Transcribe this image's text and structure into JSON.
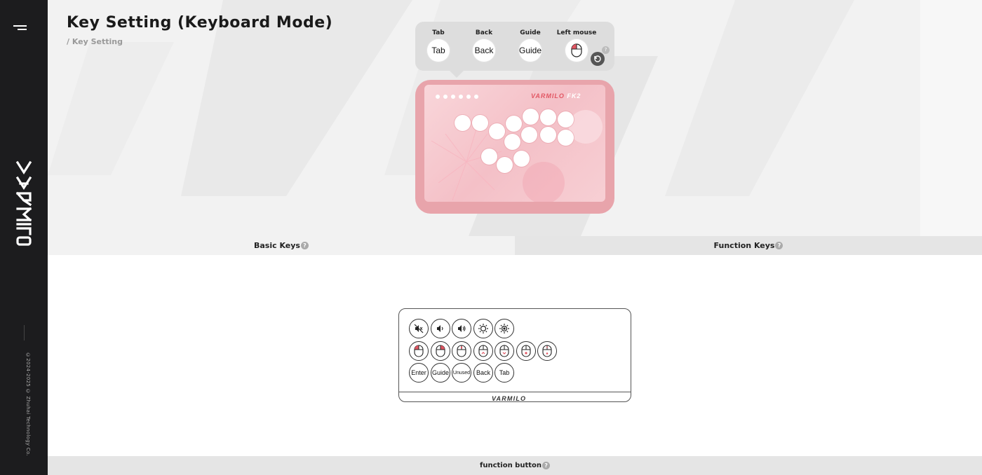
{
  "sidebar": {
    "brand": "VARMILO",
    "copyright": "©2024-2025 © Zhuhai Technology Co."
  },
  "header": {
    "title": "Key Setting (Keyboard Mode)",
    "breadcrumb": "/ Key Setting"
  },
  "keymap": {
    "keys": [
      {
        "label": "Tab",
        "value": "Tab"
      },
      {
        "label": "Back",
        "value": "Back"
      },
      {
        "label": "Guide",
        "value": "Guide"
      },
      {
        "label": "Left mouse",
        "value": "mouse-left-icon"
      }
    ],
    "reset_icon": "reset-icon",
    "help": "?"
  },
  "device": {
    "brand": "VARMILO",
    "model": "FK2",
    "accent": "#e8a4ab"
  },
  "tabs": [
    {
      "label": "Basic Keys",
      "help": "?"
    },
    {
      "label": "Function Keys",
      "help": "?"
    }
  ],
  "function_panel": {
    "row1": [
      "mute-icon",
      "volume-down-icon",
      "volume-up-icon",
      "brightness-down-icon",
      "brightness-up-icon"
    ],
    "row2": [
      "mouse-left-icon",
      "mouse-right-icon",
      "mouse-middle-icon",
      "mouse-scroll-up-icon",
      "mouse-scroll-down-icon",
      "mouse-back-icon",
      "mouse-forward-icon"
    ],
    "row3": [
      "Enter",
      "Guide",
      "Unused",
      "Back",
      "Tab"
    ],
    "brand": "VARMILO"
  },
  "footer": {
    "label": "function button",
    "help": "?"
  }
}
